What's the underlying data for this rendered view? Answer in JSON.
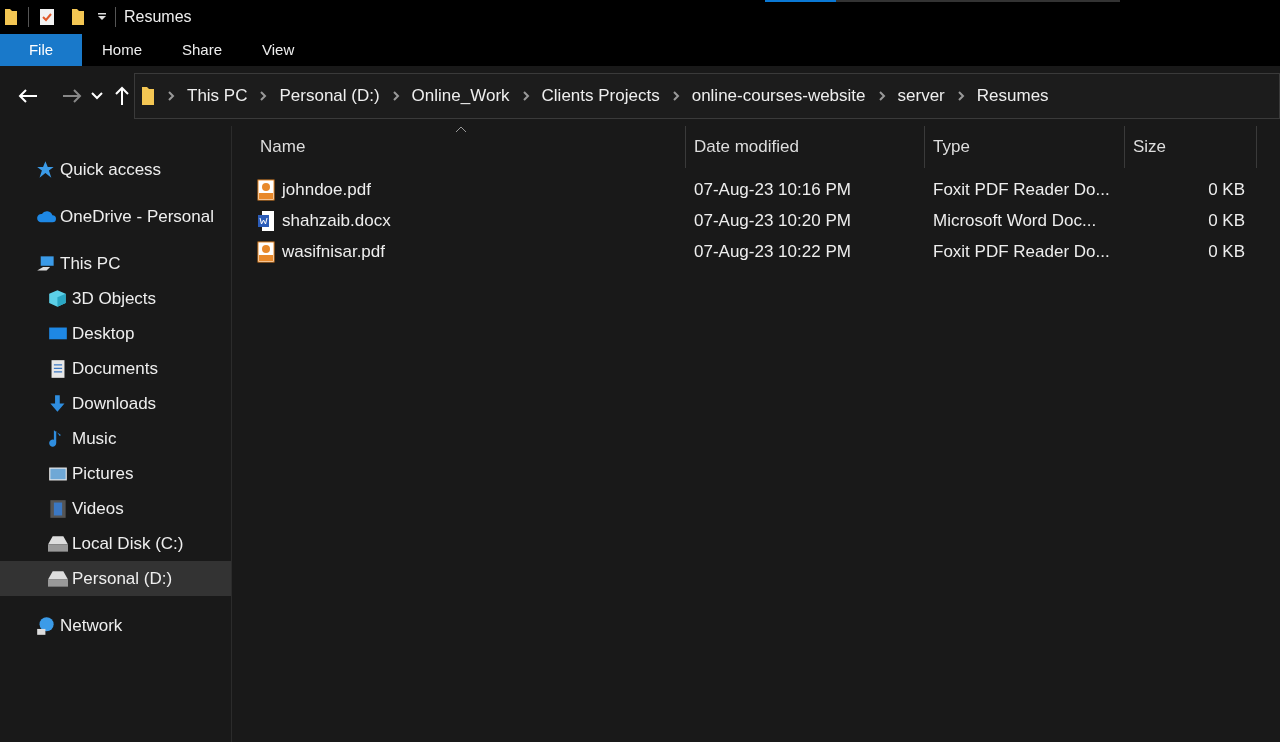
{
  "window": {
    "title": "Resumes"
  },
  "progress": {
    "level": 0.2
  },
  "ribbon_tabs": [
    {
      "label": "File",
      "selected": true
    },
    {
      "label": "Home",
      "selected": false
    },
    {
      "label": "Share",
      "selected": false
    },
    {
      "label": "View",
      "selected": false
    }
  ],
  "breadcrumb": [
    "This PC",
    "Personal (D:)",
    "Online_Work",
    "Clients Projects",
    "online-courses-website",
    "server",
    "Resumes"
  ],
  "sidebar": {
    "items": [
      {
        "label": "Quick access",
        "kind": "star",
        "selected": false
      },
      {
        "label": "OneDrive - Personal",
        "kind": "cloud",
        "selected": false
      },
      {
        "label": "This PC",
        "kind": "pc",
        "selected": false,
        "children": [
          {
            "label": "3D Objects",
            "kind": "cube",
            "selected": false
          },
          {
            "label": "Desktop",
            "kind": "desktop",
            "selected": false
          },
          {
            "label": "Documents",
            "kind": "document",
            "selected": false
          },
          {
            "label": "Downloads",
            "kind": "download",
            "selected": false
          },
          {
            "label": "Music",
            "kind": "music",
            "selected": false
          },
          {
            "label": "Pictures",
            "kind": "picture",
            "selected": false
          },
          {
            "label": "Videos",
            "kind": "video",
            "selected": false
          },
          {
            "label": "Local Disk (C:)",
            "kind": "drive",
            "selected": false
          },
          {
            "label": "Personal (D:)",
            "kind": "drive",
            "selected": true
          }
        ]
      },
      {
        "label": "Network",
        "kind": "network",
        "selected": false
      }
    ]
  },
  "table": {
    "columns": [
      "Name",
      "Date modified",
      "Type",
      "Size"
    ],
    "rows": [
      {
        "kind": "pdf",
        "name": "johndoe.pdf",
        "date": "07-Aug-23 10:16 PM",
        "type": "Foxit PDF Reader Do...",
        "size": "0 KB"
      },
      {
        "kind": "word",
        "name": "shahzaib.docx",
        "date": "07-Aug-23 10:20 PM",
        "type": "Microsoft Word Doc...",
        "size": "0 KB"
      },
      {
        "kind": "pdf",
        "name": "wasifnisar.pdf",
        "date": "07-Aug-23 10:22 PM",
        "type": "Foxit PDF Reader Do...",
        "size": "0 KB"
      }
    ]
  }
}
